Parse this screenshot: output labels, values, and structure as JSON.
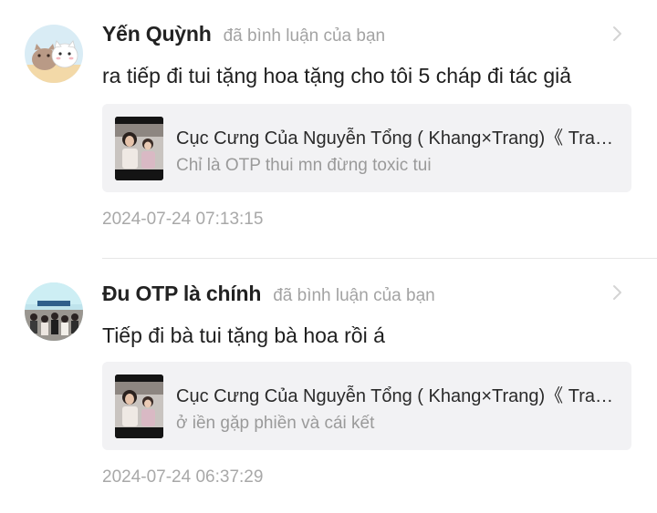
{
  "notifications": [
    {
      "username": "Yến Quỳnh",
      "action": "đã bình luận của bạn",
      "comment": "ra tiếp đi tui tặng hoa tặng cho tôi 5 cháp đi tác giả",
      "card": {
        "title": "Cục Cưng Của Nguyễn Tổng ( Khang×Trang)《 Trang Khang 》",
        "subtitle": "Chỉ là OTP thui mn đừng toxic tui"
      },
      "timestamp": "2024-07-24 07:13:15",
      "avatar_icon": "cartoon-cats-avatar-icon"
    },
    {
      "username": "Đu OTP là chính",
      "action": "đã bình luận của bạn",
      "comment": "Tiếp đi bà tui tặng bà hoa rồi á",
      "card": {
        "title": "Cục Cưng Của Nguyễn Tổng ( Khang×Trang)《 Trang Khang 》",
        "subtitle": "ở iền gặp phiền và cái kết"
      },
      "timestamp": "2024-07-24 06:37:29",
      "avatar_icon": "group-photo-avatar-icon"
    }
  ],
  "colors": {
    "background": "#ffffff",
    "card_background": "#f2f2f4",
    "secondary_text": "#a3a3a3",
    "primary_text": "#222222"
  },
  "icons": {
    "chevron": "chevron-right-icon",
    "thumbnail": "book-cover-thumbnail"
  }
}
